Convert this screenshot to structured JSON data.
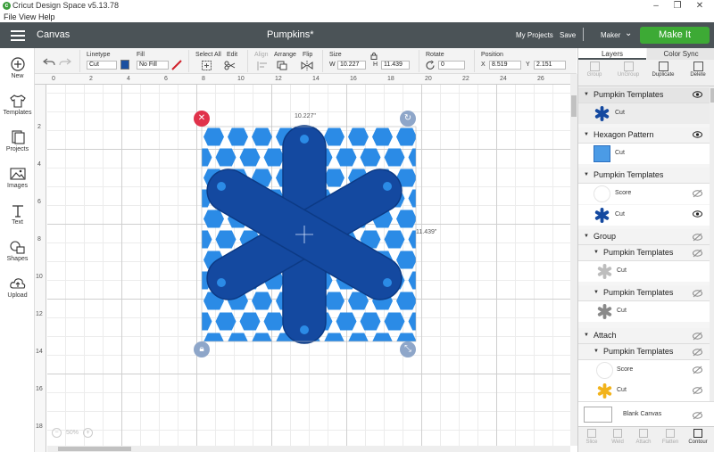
{
  "app": {
    "window_title": "Cricut Design Space   v5.13.78",
    "logo_glyph": "c"
  },
  "menu": [
    "File",
    "View",
    "Help"
  ],
  "header": {
    "canvas_label": "Canvas",
    "project_name": "Pumpkins*",
    "my_projects": "My Projects",
    "save": "Save",
    "machine": "Maker",
    "make_it": "Make It"
  },
  "left_nav": [
    {
      "label": "New",
      "icon": "plus-icon"
    },
    {
      "label": "Templates",
      "icon": "shirt-icon"
    },
    {
      "label": "Projects",
      "icon": "projects-icon"
    },
    {
      "label": "Images",
      "icon": "image-icon"
    },
    {
      "label": "Text",
      "icon": "text-icon"
    },
    {
      "label": "Shapes",
      "icon": "shapes-icon"
    },
    {
      "label": "Upload",
      "icon": "upload-icon"
    }
  ],
  "toolbar": {
    "linetype_label": "Linetype",
    "linetype_value": "Cut",
    "fill_label": "Fill",
    "fill_value": "No Fill",
    "select_all": "Select All",
    "edit": "Edit",
    "align": "Align",
    "arrange": "Arrange",
    "flip": "Flip",
    "size_label": "Size",
    "w_label": "W",
    "w_value": "10.227",
    "h_label": "H",
    "h_value": "11.439",
    "rotate_label": "Rotate",
    "rotate_value": "0",
    "position_label": "Position",
    "x_label": "X",
    "x_value": "8.519",
    "y_label": "Y",
    "y_value": "2.151",
    "linetype_color": "#1a4fa0",
    "pen_color": "#d0202a"
  },
  "rulers": {
    "horizontal": [
      "0",
      "2",
      "4",
      "6",
      "8",
      "10",
      "12",
      "14",
      "16",
      "18",
      "20",
      "22",
      "24",
      "26"
    ],
    "vertical": [
      "2",
      "4",
      "6",
      "8",
      "10",
      "12",
      "14",
      "16",
      "18"
    ]
  },
  "selection": {
    "width_label": "10.227\"",
    "height_label": "11.439\""
  },
  "zoom": {
    "value": "50%"
  },
  "panel": {
    "tabs": [
      "Layers",
      "Color Sync"
    ],
    "actions": [
      "Group",
      "UnGroup",
      "Duplicate",
      "Delete"
    ],
    "layers": {
      "g1": {
        "name": "Pumpkin Templates",
        "item": "Cut"
      },
      "g2": {
        "name": "Hexagon Pattern",
        "item": "Cut"
      },
      "g3": {
        "name": "Pumpkin Templates",
        "items": [
          "Score",
          "Cut"
        ]
      },
      "g4": {
        "name": "Group",
        "sub1": "Pumpkin Templates",
        "sub1_item": "Cut",
        "sub2": "Pumpkin Templates",
        "sub2_item": "Cut"
      },
      "g5": {
        "name": "Attach",
        "sub1": "Pumpkin Templates",
        "sub1_items": [
          "Score",
          "Cut"
        ]
      }
    },
    "blank_canvas": "Blank Canvas",
    "bottom_actions": [
      "Slice",
      "Weld",
      "Attach",
      "Flatten",
      "Contour"
    ]
  },
  "colors": {
    "header_bg": "#4b5357",
    "make_it": "#3daa35",
    "asterisk_blue": "#1449a0",
    "hex_blue": "#2b8be6",
    "grey_asterisk": "#999999",
    "yellow_asterisk": "#f2b31b"
  }
}
